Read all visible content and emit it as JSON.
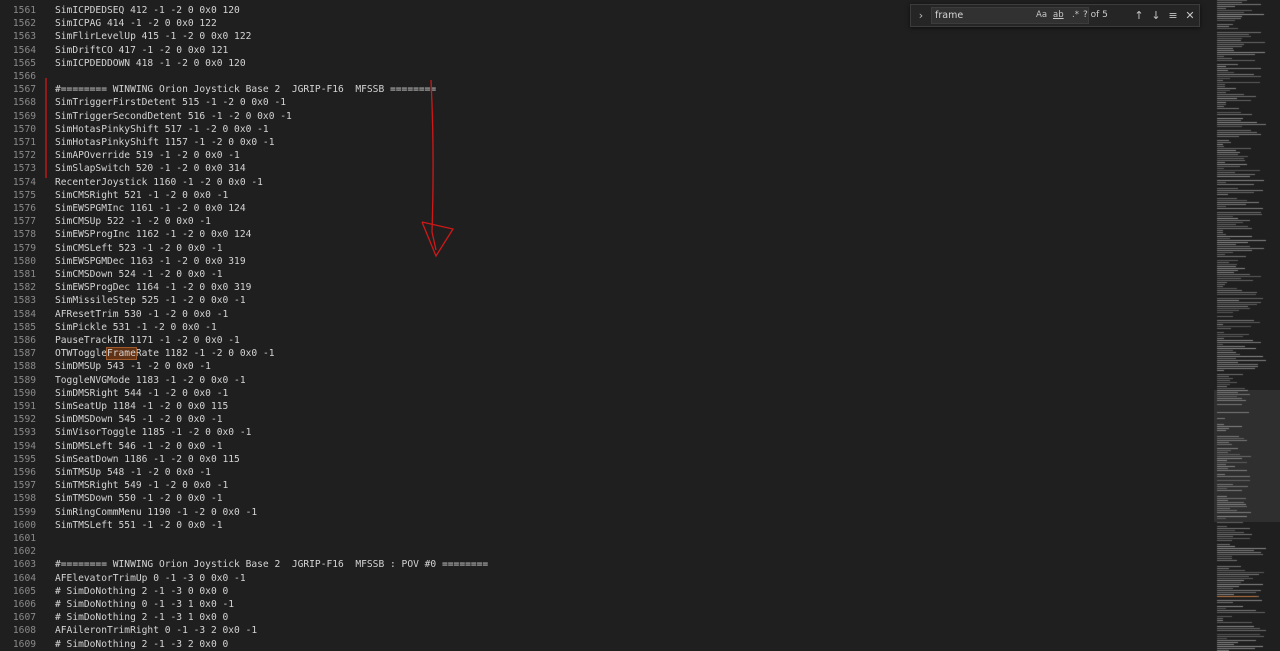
{
  "editor": {
    "lines": [
      {
        "number": "1561",
        "text": "SimICPDEDSEQ 412 -1 -2 0 0x0 120"
      },
      {
        "number": "1562",
        "text": "SimICPAG 414 -1 -2 0 0x0 122"
      },
      {
        "number": "1563",
        "text": "SimFlirLevelUp 415 -1 -2 0 0x0 122"
      },
      {
        "number": "1564",
        "text": "SimDriftCO 417 -1 -2 0 0x0 121"
      },
      {
        "number": "1565",
        "text": "SimICPDEDDOWN 418 -1 -2 0 0x0 120"
      },
      {
        "number": "1566",
        "text": ""
      },
      {
        "number": "1567",
        "text": "#======== WINWING Orion Joystick Base 2  JGRIP-F16  MFSSB ========"
      },
      {
        "number": "1568",
        "text": "SimTriggerFirstDetent 515 -1 -2 0 0x0 -1"
      },
      {
        "number": "1569",
        "text": "SimTriggerSecondDetent 516 -1 -2 0 0x0 -1"
      },
      {
        "number": "1570",
        "text": "SimHotasPinkyShift 517 -1 -2 0 0x0 -1"
      },
      {
        "number": "1571",
        "text": "SimHotasPinkyShift 1157 -1 -2 0 0x0 -1"
      },
      {
        "number": "1572",
        "text": "SimAPOverride 519 -1 -2 0 0x0 -1"
      },
      {
        "number": "1573",
        "text": "SimSlapSwitch 520 -1 -2 0 0x0 314"
      },
      {
        "number": "1574",
        "text": "RecenterJoystick 1160 -1 -2 0 0x0 -1"
      },
      {
        "number": "1575",
        "text": "SimCMSRight 521 -1 -2 0 0x0 -1"
      },
      {
        "number": "1576",
        "text": "SimEWSPGMInc 1161 -1 -2 0 0x0 124"
      },
      {
        "number": "1577",
        "text": "SimCMSUp 522 -1 -2 0 0x0 -1"
      },
      {
        "number": "1578",
        "text": "SimEWSProgInc 1162 -1 -2 0 0x0 124"
      },
      {
        "number": "1579",
        "text": "SimCMSLeft 523 -1 -2 0 0x0 -1"
      },
      {
        "number": "1580",
        "text": "SimEWSPGMDec 1163 -1 -2 0 0x0 319"
      },
      {
        "number": "1581",
        "text": "SimCMSDown 524 -1 -2 0 0x0 -1"
      },
      {
        "number": "1582",
        "text": "SimEWSProgDec 1164 -1 -2 0 0x0 319"
      },
      {
        "number": "1583",
        "text": "SimMissileStep 525 -1 -2 0 0x0 -1"
      },
      {
        "number": "1584",
        "text": "AFResetTrim 530 -1 -2 0 0x0 -1"
      },
      {
        "number": "1585",
        "text": "SimPickle 531 -1 -2 0 0x0 -1"
      },
      {
        "number": "1586",
        "text": "PauseTrackIR 1171 -1 -2 0 0x0 -1"
      },
      {
        "number": "1587",
        "pre": "OTWToggle",
        "match": "Frame",
        "post": "Rate 1182 -1 -2 0 0x0 -1"
      },
      {
        "number": "1588",
        "text": "SimDMSUp 543 -1 -2 0 0x0 -1"
      },
      {
        "number": "1589",
        "text": "ToggleNVGMode 1183 -1 -2 0 0x0 -1"
      },
      {
        "number": "1590",
        "text": "SimDMSRight 544 -1 -2 0 0x0 -1"
      },
      {
        "number": "1591",
        "text": "SimSeatUp 1184 -1 -2 0 0x0 115"
      },
      {
        "number": "1592",
        "text": "SimDMSDown 545 -1 -2 0 0x0 -1"
      },
      {
        "number": "1593",
        "text": "SimVisorToggle 1185 -1 -2 0 0x0 -1"
      },
      {
        "number": "1594",
        "text": "SimDMSLeft 546 -1 -2 0 0x0 -1"
      },
      {
        "number": "1595",
        "text": "SimSeatDown 1186 -1 -2 0 0x0 115"
      },
      {
        "number": "1596",
        "text": "SimTMSUp 548 -1 -2 0 0x0 -1"
      },
      {
        "number": "1597",
        "text": "SimTMSRight 549 -1 -2 0 0x0 -1"
      },
      {
        "number": "1598",
        "text": "SimTMSDown 550 -1 -2 0 0x0 -1"
      },
      {
        "number": "1599",
        "text": "SimRingCommMenu 1190 -1 -2 0 0x0 -1"
      },
      {
        "number": "1600",
        "text": "SimTMSLeft 551 -1 -2 0 0x0 -1"
      },
      {
        "number": "1601",
        "text": ""
      },
      {
        "number": "1602",
        "text": ""
      },
      {
        "number": "1603",
        "text": "#======== WINWING Orion Joystick Base 2  JGRIP-F16  MFSSB : POV #0 ========"
      },
      {
        "number": "1604",
        "text": "AFElevatorTrimUp 0 -1 -3 0 0x0 -1"
      },
      {
        "number": "1605",
        "text": "# SimDoNothing 2 -1 -3 0 0x0 0"
      },
      {
        "number": "1606",
        "text": "# SimDoNothing 0 -1 -3 1 0x0 -1"
      },
      {
        "number": "1607",
        "text": "# SimDoNothing 2 -1 -3 1 0x0 0"
      },
      {
        "number": "1608",
        "text": "AFAileronTrimRight 0 -1 -3 2 0x0 -1"
      },
      {
        "number": "1609",
        "text": "# SimDoNothing 2 -1 -3 2 0x0 0"
      }
    ]
  },
  "find": {
    "toggle_icon": "chevron-right",
    "query": "frame",
    "match_case_label": "Aa",
    "whole_word_label": "ab",
    "regex_label": ".*",
    "match_count": "? of 5",
    "prev_icon": "arrow-up",
    "next_icon": "arrow-down",
    "selection_icon": "find-in-selection",
    "close_icon": "close"
  },
  "colors": {
    "background": "#1f1f1f",
    "text": "#d4d4d4",
    "line_number": "#8a8a8a",
    "match_highlight": "#613214",
    "annotation": "#d01818"
  }
}
